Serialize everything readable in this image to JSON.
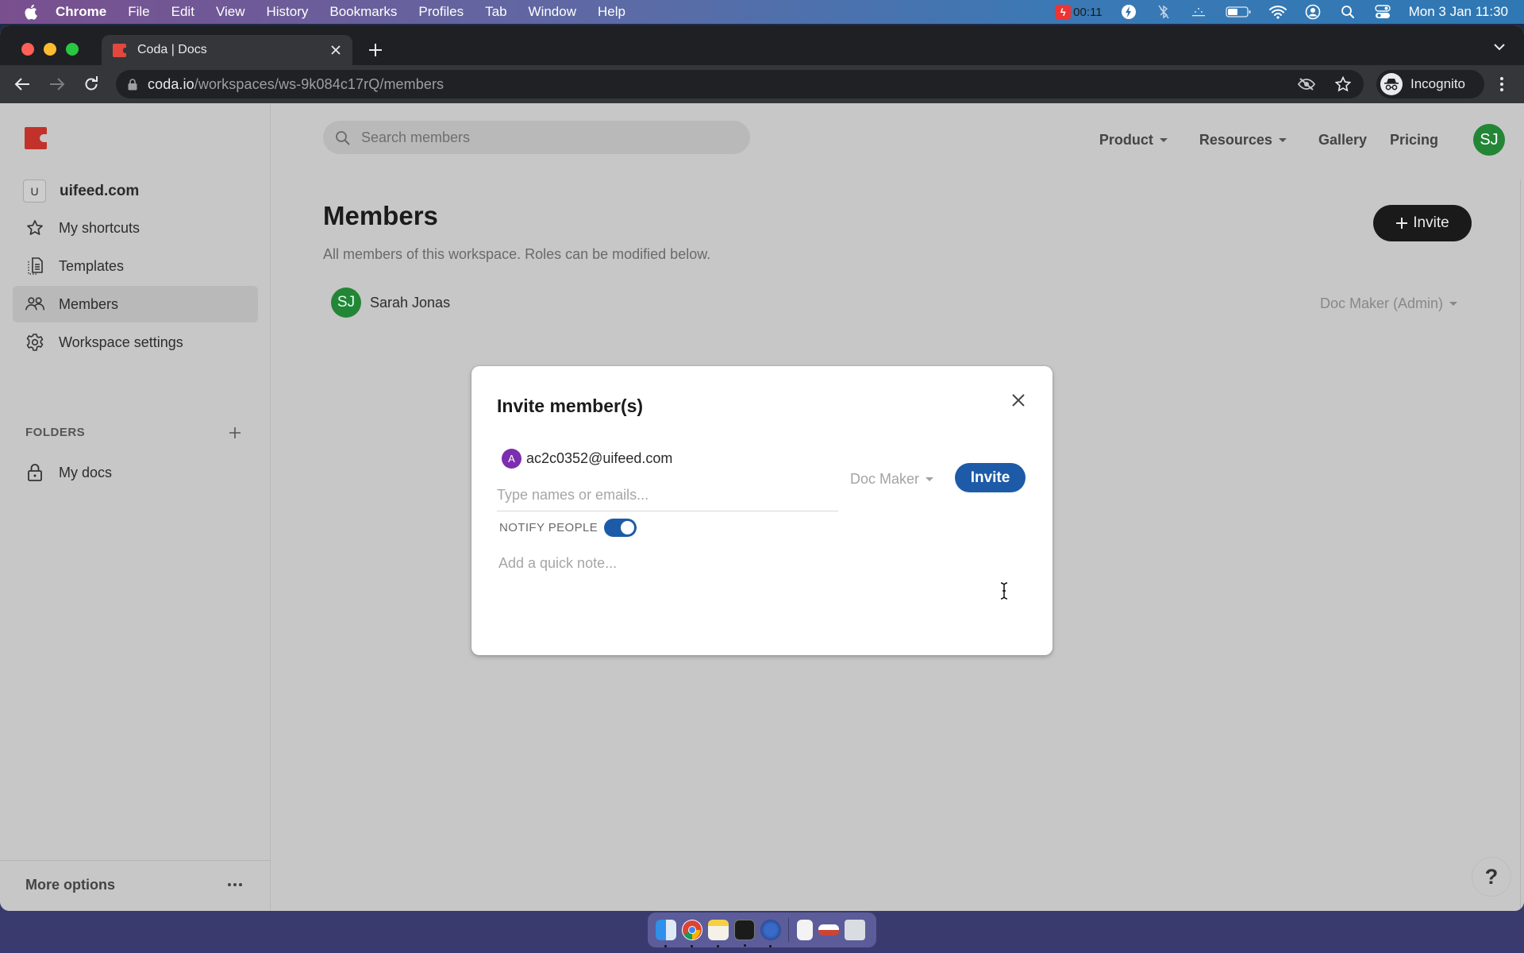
{
  "menubar": {
    "app_name": "Chrome",
    "items": [
      "File",
      "Edit",
      "View",
      "History",
      "Bookmarks",
      "Profiles",
      "Tab",
      "Window",
      "Help"
    ],
    "recording_time": "00:11",
    "datetime": "Mon 3 Jan  11:30"
  },
  "browser": {
    "tab_title": "Coda | Docs",
    "url_host": "coda.io",
    "url_path": "/workspaces/ws-9k084c17rQ/members",
    "profile_label": "Incognito"
  },
  "sidebar": {
    "workspace_initial": "U",
    "workspace_name": "uifeed.com",
    "items": [
      {
        "label": "My shortcuts",
        "icon": "star-icon"
      },
      {
        "label": "Templates",
        "icon": "templates-icon"
      },
      {
        "label": "Members",
        "icon": "members-icon",
        "active": true
      },
      {
        "label": "Workspace settings",
        "icon": "gear-icon"
      }
    ],
    "folders_heading": "FOLDERS",
    "folders": [
      {
        "label": "My docs",
        "icon": "lock-icon"
      }
    ],
    "footer_label": "More options"
  },
  "header": {
    "search_placeholder": "Search members",
    "nav": [
      {
        "label": "Product",
        "dropdown": true
      },
      {
        "label": "Resources",
        "dropdown": true
      },
      {
        "label": "Gallery",
        "dropdown": false
      },
      {
        "label": "Pricing",
        "dropdown": false
      }
    ],
    "user_initials": "SJ"
  },
  "main": {
    "title": "Members",
    "subtitle": "All members of this workspace. Roles can be modified below.",
    "invite_button": "Invite",
    "members": [
      {
        "initials": "SJ",
        "name": "Sarah Jonas",
        "role": "Doc Maker (Admin)"
      }
    ]
  },
  "modal": {
    "title": "Invite member(s)",
    "invitees": [
      {
        "initial": "A",
        "email": "ac2c0352@uifeed.com"
      }
    ],
    "names_placeholder": "Type names or emails...",
    "role": "Doc Maker",
    "invite_button": "Invite",
    "notify_label": "NOTIFY PEOPLE",
    "notify_on": true,
    "note_placeholder": "Add a quick note..."
  },
  "help_label": "?",
  "colors": {
    "coda_red": "#c2322a",
    "avatar_green": "#238636",
    "invite_blue": "#1d5ba8",
    "invitee_purple": "#7b2fae"
  }
}
